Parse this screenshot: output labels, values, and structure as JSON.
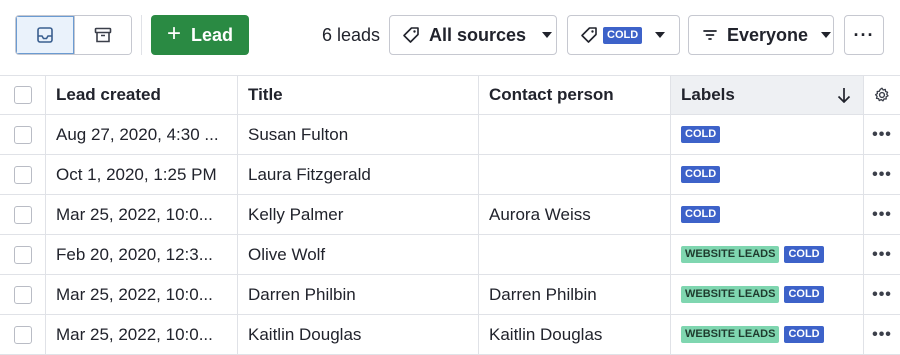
{
  "toolbar": {
    "view_list_icon": "inbox-icon",
    "view_archive_icon": "archive-icon",
    "add_button": {
      "icon": "plus",
      "label": "Lead"
    },
    "count_text": "6 leads",
    "sources_dropdown": {
      "icon": "tag-icon",
      "label": "All sources"
    },
    "labels_dropdown": {
      "icon": "tag-icon",
      "badge": "COLD"
    },
    "owner_dropdown": {
      "icon": "filter-icon",
      "label": "Everyone"
    },
    "more_button": "···"
  },
  "colors": {
    "primary_green": "#2a8a43",
    "cold_badge": "#3d62c9",
    "website_badge": "#7fd6b0",
    "active_view": "#eaf2fb"
  },
  "table": {
    "headers": {
      "created": "Lead created",
      "title": "Title",
      "contact": "Contact person",
      "labels": "Labels",
      "sort_icon": "arrow-down-icon",
      "settings_icon": "gear-icon"
    },
    "rows": [
      {
        "created": "Aug 27, 2020, 4:30 ...",
        "title": "Susan Fulton",
        "contact": "",
        "labels": [
          "COLD"
        ]
      },
      {
        "created": "Oct 1, 2020, 1:25 PM",
        "title": "Laura Fitzgerald",
        "contact": "",
        "labels": [
          "COLD"
        ]
      },
      {
        "created": "Mar 25, 2022, 10:0...",
        "title": "Kelly Palmer",
        "contact": "Aurora Weiss",
        "labels": [
          "COLD"
        ]
      },
      {
        "created": "Feb 20, 2020, 12:3...",
        "title": "Olive Wolf",
        "contact": "",
        "labels": [
          "WEBSITE LEADS",
          "COLD"
        ]
      },
      {
        "created": "Mar 25, 2022, 10:0...",
        "title": "Darren Philbin",
        "contact": "Darren Philbin",
        "labels": [
          "WEBSITE LEADS",
          "COLD"
        ]
      },
      {
        "created": "Mar 25, 2022, 10:0...",
        "title": "Kaitlin Douglas",
        "contact": "Kaitlin Douglas",
        "labels": [
          "WEBSITE LEADS",
          "COLD"
        ]
      }
    ],
    "row_action": "•••"
  }
}
